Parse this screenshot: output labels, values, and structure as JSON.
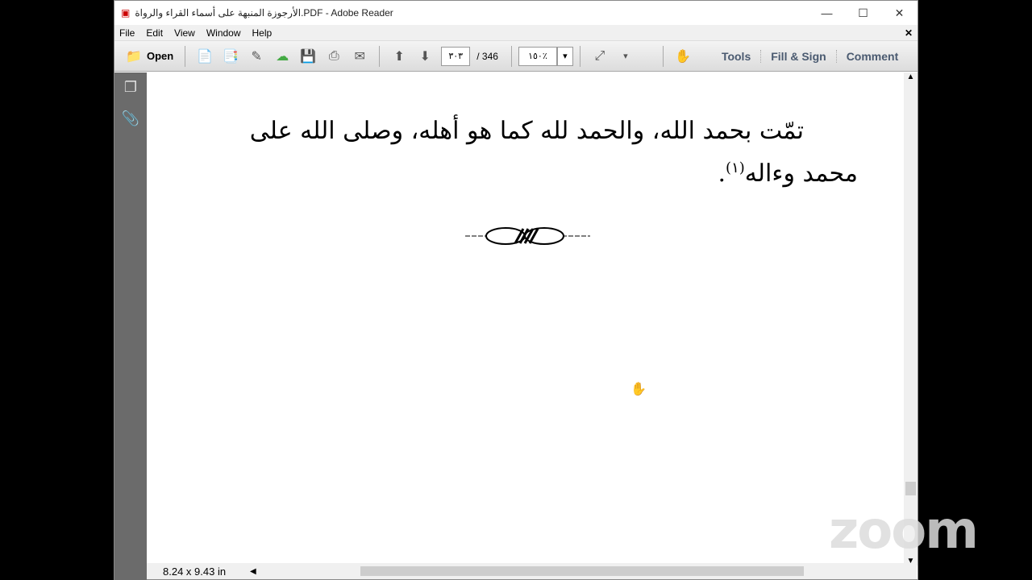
{
  "window": {
    "title": "الأرجوزة المنبهة على أسماء القراء والرواة.PDF - Adobe Reader"
  },
  "menu": [
    "File",
    "Edit",
    "View",
    "Window",
    "Help"
  ],
  "toolbar": {
    "open": "Open",
    "page_current": "٣٠٣",
    "page_total": "/ 346",
    "zoom": "١٥٠٪",
    "tools": "Tools",
    "fill_sign": "Fill & Sign",
    "comment": "Comment"
  },
  "document": {
    "line1": "تمّت بحمد الله، والحمد لله كما هو أهله، وصلى الله على",
    "line2": "محمد وءاله",
    "footnote_mark": "(١)",
    "line2_end": "."
  },
  "status": {
    "page_size": "8.24 x 9.43 in"
  },
  "overlay": {
    "logo": "zoom"
  }
}
